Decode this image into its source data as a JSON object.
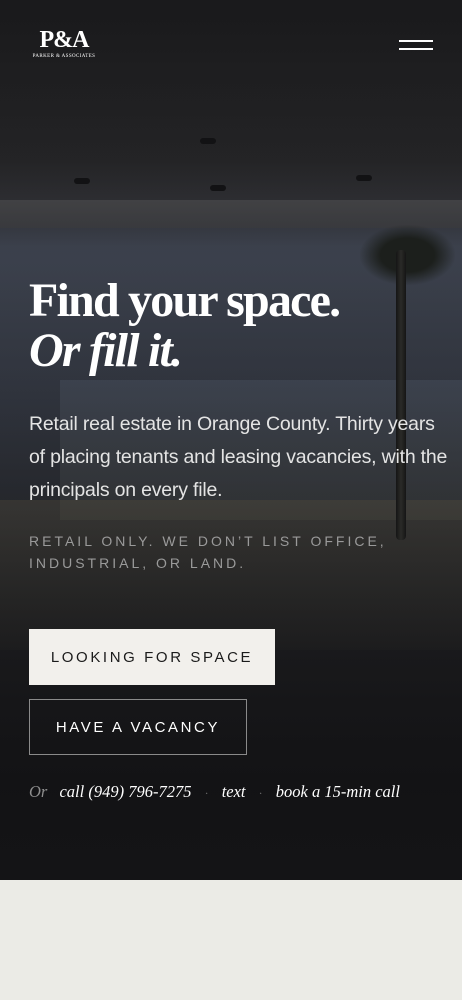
{
  "header": {
    "logo_mark": "P&A",
    "logo_sub": "PARKER & ASSOCIATES"
  },
  "hero": {
    "headline_line1": "Find your space.",
    "headline_line2": "Or fill it.",
    "lede": "Retail real estate in Orange County. Thirty years of placing tenants and leasing vacancies, with the principals on every file.",
    "note": "Retail only. We don’t list office, industrial, or land.",
    "primary_cta": "LOOKING FOR SPACE",
    "secondary_cta": "HAVE A VACANCY",
    "contact": {
      "prefix": "Or",
      "call": "call (949) 796-7275",
      "text": "text",
      "book": "book a 15-min call",
      "separator": "·"
    }
  },
  "colors": {
    "hero_dark": "#141416",
    "page_bg": "#ebebe6",
    "primary_button_bg": "#f2f0ec",
    "primary_button_text": "#1b1b1b"
  },
  "icons": {
    "menu": "hamburger-menu-icon"
  }
}
